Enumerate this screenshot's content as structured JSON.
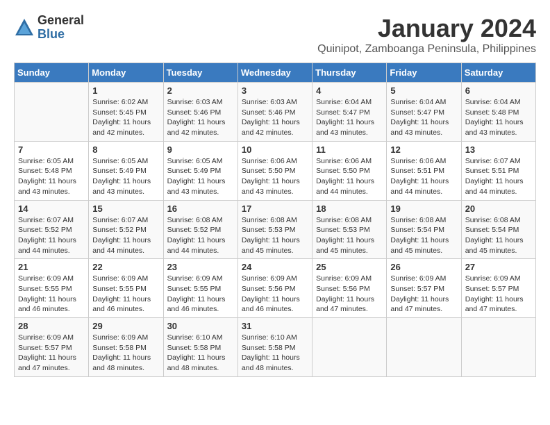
{
  "logo": {
    "general": "General",
    "blue": "Blue"
  },
  "title": "January 2024",
  "subtitle": "Quinipot, Zamboanga Peninsula, Philippines",
  "days_header": [
    "Sunday",
    "Monday",
    "Tuesday",
    "Wednesday",
    "Thursday",
    "Friday",
    "Saturday"
  ],
  "weeks": [
    [
      {
        "day": "",
        "info": ""
      },
      {
        "day": "1",
        "info": "Sunrise: 6:02 AM\nSunset: 5:45 PM\nDaylight: 11 hours\nand 42 minutes."
      },
      {
        "day": "2",
        "info": "Sunrise: 6:03 AM\nSunset: 5:46 PM\nDaylight: 11 hours\nand 42 minutes."
      },
      {
        "day": "3",
        "info": "Sunrise: 6:03 AM\nSunset: 5:46 PM\nDaylight: 11 hours\nand 42 minutes."
      },
      {
        "day": "4",
        "info": "Sunrise: 6:04 AM\nSunset: 5:47 PM\nDaylight: 11 hours\nand 43 minutes."
      },
      {
        "day": "5",
        "info": "Sunrise: 6:04 AM\nSunset: 5:47 PM\nDaylight: 11 hours\nand 43 minutes."
      },
      {
        "day": "6",
        "info": "Sunrise: 6:04 AM\nSunset: 5:48 PM\nDaylight: 11 hours\nand 43 minutes."
      }
    ],
    [
      {
        "day": "7",
        "info": "Sunrise: 6:05 AM\nSunset: 5:48 PM\nDaylight: 11 hours\nand 43 minutes."
      },
      {
        "day": "8",
        "info": "Sunrise: 6:05 AM\nSunset: 5:49 PM\nDaylight: 11 hours\nand 43 minutes."
      },
      {
        "day": "9",
        "info": "Sunrise: 6:05 AM\nSunset: 5:49 PM\nDaylight: 11 hours\nand 43 minutes."
      },
      {
        "day": "10",
        "info": "Sunrise: 6:06 AM\nSunset: 5:50 PM\nDaylight: 11 hours\nand 43 minutes."
      },
      {
        "day": "11",
        "info": "Sunrise: 6:06 AM\nSunset: 5:50 PM\nDaylight: 11 hours\nand 44 minutes."
      },
      {
        "day": "12",
        "info": "Sunrise: 6:06 AM\nSunset: 5:51 PM\nDaylight: 11 hours\nand 44 minutes."
      },
      {
        "day": "13",
        "info": "Sunrise: 6:07 AM\nSunset: 5:51 PM\nDaylight: 11 hours\nand 44 minutes."
      }
    ],
    [
      {
        "day": "14",
        "info": "Sunrise: 6:07 AM\nSunset: 5:52 PM\nDaylight: 11 hours\nand 44 minutes."
      },
      {
        "day": "15",
        "info": "Sunrise: 6:07 AM\nSunset: 5:52 PM\nDaylight: 11 hours\nand 44 minutes."
      },
      {
        "day": "16",
        "info": "Sunrise: 6:08 AM\nSunset: 5:52 PM\nDaylight: 11 hours\nand 44 minutes."
      },
      {
        "day": "17",
        "info": "Sunrise: 6:08 AM\nSunset: 5:53 PM\nDaylight: 11 hours\nand 45 minutes."
      },
      {
        "day": "18",
        "info": "Sunrise: 6:08 AM\nSunset: 5:53 PM\nDaylight: 11 hours\nand 45 minutes."
      },
      {
        "day": "19",
        "info": "Sunrise: 6:08 AM\nSunset: 5:54 PM\nDaylight: 11 hours\nand 45 minutes."
      },
      {
        "day": "20",
        "info": "Sunrise: 6:08 AM\nSunset: 5:54 PM\nDaylight: 11 hours\nand 45 minutes."
      }
    ],
    [
      {
        "day": "21",
        "info": "Sunrise: 6:09 AM\nSunset: 5:55 PM\nDaylight: 11 hours\nand 46 minutes."
      },
      {
        "day": "22",
        "info": "Sunrise: 6:09 AM\nSunset: 5:55 PM\nDaylight: 11 hours\nand 46 minutes."
      },
      {
        "day": "23",
        "info": "Sunrise: 6:09 AM\nSunset: 5:55 PM\nDaylight: 11 hours\nand 46 minutes."
      },
      {
        "day": "24",
        "info": "Sunrise: 6:09 AM\nSunset: 5:56 PM\nDaylight: 11 hours\nand 46 minutes."
      },
      {
        "day": "25",
        "info": "Sunrise: 6:09 AM\nSunset: 5:56 PM\nDaylight: 11 hours\nand 47 minutes."
      },
      {
        "day": "26",
        "info": "Sunrise: 6:09 AM\nSunset: 5:57 PM\nDaylight: 11 hours\nand 47 minutes."
      },
      {
        "day": "27",
        "info": "Sunrise: 6:09 AM\nSunset: 5:57 PM\nDaylight: 11 hours\nand 47 minutes."
      }
    ],
    [
      {
        "day": "28",
        "info": "Sunrise: 6:09 AM\nSunset: 5:57 PM\nDaylight: 11 hours\nand 47 minutes."
      },
      {
        "day": "29",
        "info": "Sunrise: 6:09 AM\nSunset: 5:58 PM\nDaylight: 11 hours\nand 48 minutes."
      },
      {
        "day": "30",
        "info": "Sunrise: 6:10 AM\nSunset: 5:58 PM\nDaylight: 11 hours\nand 48 minutes."
      },
      {
        "day": "31",
        "info": "Sunrise: 6:10 AM\nSunset: 5:58 PM\nDaylight: 11 hours\nand 48 minutes."
      },
      {
        "day": "",
        "info": ""
      },
      {
        "day": "",
        "info": ""
      },
      {
        "day": "",
        "info": ""
      }
    ]
  ]
}
